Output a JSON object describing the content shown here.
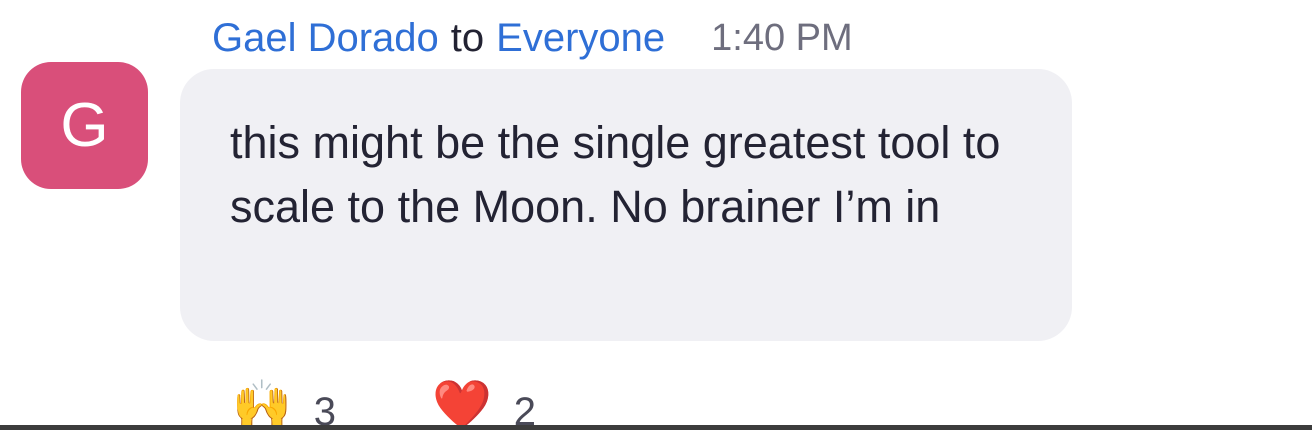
{
  "message": {
    "sender": "Gael Dorado",
    "to_word": "to",
    "recipient": "Everyone",
    "time": "1:40 PM",
    "avatar_initial": "G",
    "text": "this might be the single greatest tool to scale to the Moon. No brainer I’m in"
  },
  "reactions": [
    {
      "emoji": "🙌",
      "count": "3",
      "icon": "raising-hands-icon"
    },
    {
      "emoji": "❤️",
      "count": "2",
      "icon": "red-heart-icon"
    }
  ],
  "colors": {
    "name_link": "#2f6fd6",
    "avatar_bg": "#d94f7a",
    "bubble_bg": "#f0f0f4",
    "text": "#232333",
    "timestamp": "#6e6e7e"
  }
}
